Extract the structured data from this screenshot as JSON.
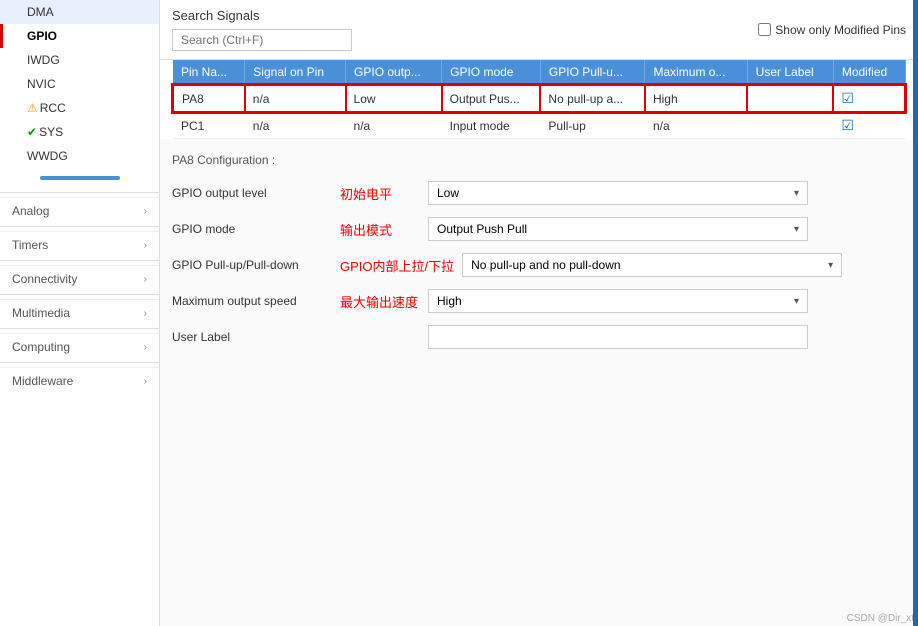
{
  "sidebar": {
    "items": [
      {
        "id": "dma",
        "label": "DMA",
        "icon": null,
        "active": false,
        "indent": true
      },
      {
        "id": "gpio",
        "label": "GPIO",
        "icon": null,
        "active": true,
        "indent": true
      },
      {
        "id": "iwdg",
        "label": "IWDG",
        "icon": null,
        "active": false,
        "indent": true
      },
      {
        "id": "nvic",
        "label": "NVIC",
        "icon": null,
        "active": false,
        "indent": true
      },
      {
        "id": "rcc",
        "label": "RCC",
        "icon": "warning",
        "active": false,
        "indent": true
      },
      {
        "id": "sys",
        "label": "SYS",
        "icon": "check",
        "active": false,
        "indent": true
      },
      {
        "id": "wwdg",
        "label": "WWDG",
        "icon": null,
        "active": false,
        "indent": true
      }
    ],
    "categories": [
      {
        "id": "analog",
        "label": "Analog"
      },
      {
        "id": "timers",
        "label": "Timers"
      },
      {
        "id": "connectivity",
        "label": "Connectivity"
      },
      {
        "id": "multimedia",
        "label": "Multimedia"
      },
      {
        "id": "computing",
        "label": "Computing"
      },
      {
        "id": "middleware",
        "label": "Middleware"
      }
    ]
  },
  "topbar": {
    "title": "Search Signals",
    "search_placeholder": "Search (Ctrl+F)",
    "show_modified_label": "Show only Modified Pins"
  },
  "table": {
    "columns": [
      "Pin Na...",
      "Signal on Pin",
      "GPIO outp...",
      "GPIO mode",
      "GPIO Pull-u...",
      "Maximum o...",
      "User Label",
      "Modified"
    ],
    "rows": [
      {
        "pin": "PA8",
        "signal": "n/a",
        "output": "Low",
        "mode": "Output Pus...",
        "pull": "No pull-up a...",
        "max": "High",
        "label": "",
        "modified": true,
        "selected": true
      },
      {
        "pin": "PC1",
        "signal": "n/a",
        "output": "n/a",
        "mode": "Input mode",
        "pull": "Pull-up",
        "max": "n/a",
        "label": "",
        "modified": true,
        "selected": false
      }
    ]
  },
  "config": {
    "title": "PA8 Configuration :",
    "rows": [
      {
        "id": "output-level",
        "label": "GPIO output level",
        "label_cn": "初始电平",
        "value": "Low"
      },
      {
        "id": "mode",
        "label": "GPIO mode",
        "label_cn": "输出模式",
        "value": "Output Push Pull"
      },
      {
        "id": "pull",
        "label": "GPIO Pull-up/Pull-down",
        "label_cn": "GPIO内部上拉/下拉",
        "value": "No pull-up and no pull-down"
      },
      {
        "id": "max-speed",
        "label": "Maximum output speed",
        "label_cn": "最大输出速度",
        "value": "High"
      }
    ],
    "user_label": "User Label"
  },
  "watermark": "CSDN @Dir_xt"
}
